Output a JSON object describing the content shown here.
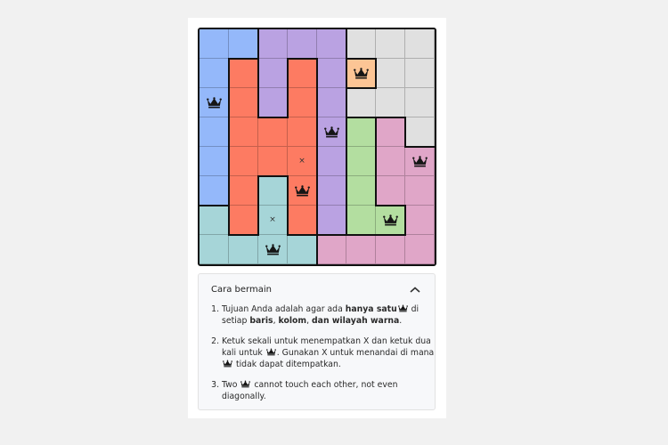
{
  "colors": {
    "blue": "#94b8fa",
    "purple": "#baa2e2",
    "grey": "#e0e0e0",
    "orange": "#fcc595",
    "red": "#fd7b62",
    "green": "#b3dea0",
    "pink": "#e0a6c8",
    "teal": "#a6d5d8"
  },
  "board": {
    "size": 8,
    "regions": [
      "BBPPPGGG",
      "BRPRPOGG",
      "BRPRPGGG",
      "BRRRPLNG",
      "BRRRPLNN",
      "BRTRPLNN",
      "TRTRPLLN",
      "TTTTNNNN"
    ],
    "region_key": {
      "B": "blue",
      "P": "purple",
      "G": "grey",
      "O": "orange",
      "R": "red",
      "L": "green",
      "N": "pink",
      "T": "teal"
    },
    "crowns": [
      [
        1,
        5
      ],
      [
        2,
        0
      ],
      [
        3,
        4
      ],
      [
        4,
        7
      ],
      [
        5,
        3
      ],
      [
        6,
        6
      ],
      [
        7,
        2
      ]
    ],
    "x_marks": [
      [
        4,
        3
      ],
      [
        6,
        2
      ]
    ],
    "crown_icon": "crown-icon",
    "x_symbol": "×"
  },
  "howto": {
    "title": "Cara bermain",
    "collapse_icon": "chevron-up-icon",
    "items": [
      {
        "a": "Tujuan Anda adalah agar ada ",
        "b": "hanya satu",
        "c": " di setiap ",
        "d": "baris",
        "e": ", ",
        "f": "kolom",
        "g": ", ",
        "h": "dan wilayah warna",
        "i": "."
      },
      {
        "a": "Ketuk sekali untuk menempatkan X dan ketuk dua kali untuk ",
        "b": ". Gunakan X untuk menandai di mana ",
        "c": " tidak dapat ditempatkan."
      },
      {
        "a": "Two ",
        "b": " cannot touch each other, not even diagonally."
      }
    ]
  }
}
